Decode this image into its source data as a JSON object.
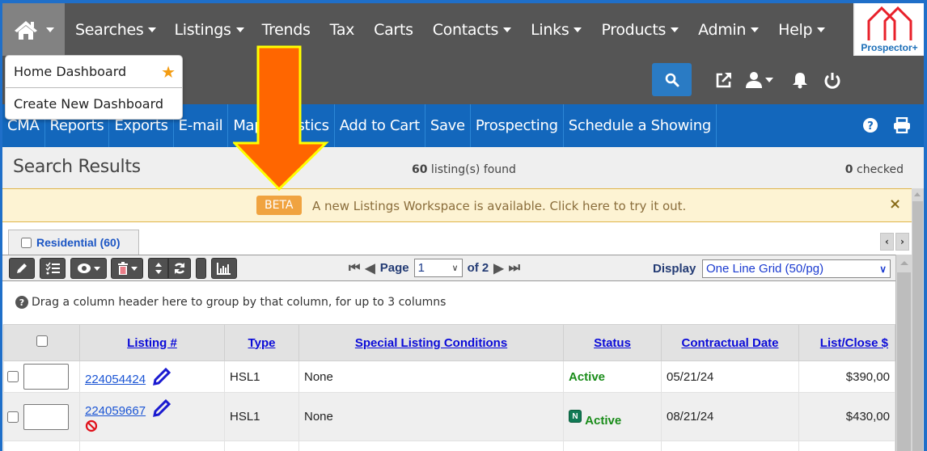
{
  "topnav": {
    "home_caret": "home-dropdown",
    "items": [
      {
        "label": "Searches",
        "has_caret": true
      },
      {
        "label": "Listings",
        "has_caret": true
      },
      {
        "label": "Trends",
        "has_caret": false
      },
      {
        "label": "Tax",
        "has_caret": false
      },
      {
        "label": "Carts",
        "has_caret": false
      },
      {
        "label": "Contacts",
        "has_caret": true
      },
      {
        "label": "Links",
        "has_caret": true
      },
      {
        "label": "Products",
        "has_caret": true
      },
      {
        "label": "Admin",
        "has_caret": true
      },
      {
        "label": "Help",
        "has_caret": true
      }
    ]
  },
  "logo": {
    "text": "Prospector+"
  },
  "home_dropdown": {
    "items": [
      {
        "label": "Home Dashboard",
        "starred": true
      },
      {
        "label": "Create New Dashboard",
        "starred": false
      }
    ]
  },
  "actionbar": {
    "items": [
      "CMA",
      "Reports",
      "Exports",
      "E-mail",
      "Map",
      "Statistics",
      "Add to Cart",
      "Save",
      "Prospecting",
      "Schedule a Showing"
    ]
  },
  "results": {
    "title": "Search Results",
    "found_count": "60",
    "found_suffix": " listing(s) found",
    "checked_count": "0",
    "checked_suffix": " checked"
  },
  "beta": {
    "tag": "BETA",
    "message": "A new Listings Workspace is available. Click here to try it out.",
    "close": "×"
  },
  "tab": {
    "label": "Residential (60)"
  },
  "pager": {
    "page_label": "Page",
    "current_page": "1",
    "of_label": "of 2",
    "display_label": "Display",
    "display_value": "One Line Grid (50/pg)"
  },
  "group_hint": "Drag a column header here to group by that column, for up to 3 columns",
  "grid": {
    "columns": [
      "Listing #",
      "Type",
      "Special Listing Conditions",
      "Status",
      "Contractual Date",
      "List/Close $"
    ],
    "rows": [
      {
        "listing": "224054424",
        "type": "HSL1",
        "conditions": "None",
        "status": "Active",
        "new_badge": false,
        "date": "05/21/24",
        "price": "$390,00",
        "restricted": false
      },
      {
        "listing": "224059667",
        "type": "HSL1",
        "conditions": "None",
        "status": "Active",
        "new_badge": true,
        "date": "08/21/24",
        "price": "$430,00",
        "restricted": true
      }
    ],
    "badge_letter": "N"
  },
  "colors": {
    "nav_bg": "#555555",
    "action_bg": "#1367bc",
    "beta_bg": "#fdf3d3",
    "beta_tag": "#f0a340",
    "arrow_fill": "#ff6600",
    "arrow_stroke": "#ffff00",
    "active_status": "#198c19",
    "logo_red": "#e8202a",
    "logo_blue": "#1c6fb8"
  }
}
